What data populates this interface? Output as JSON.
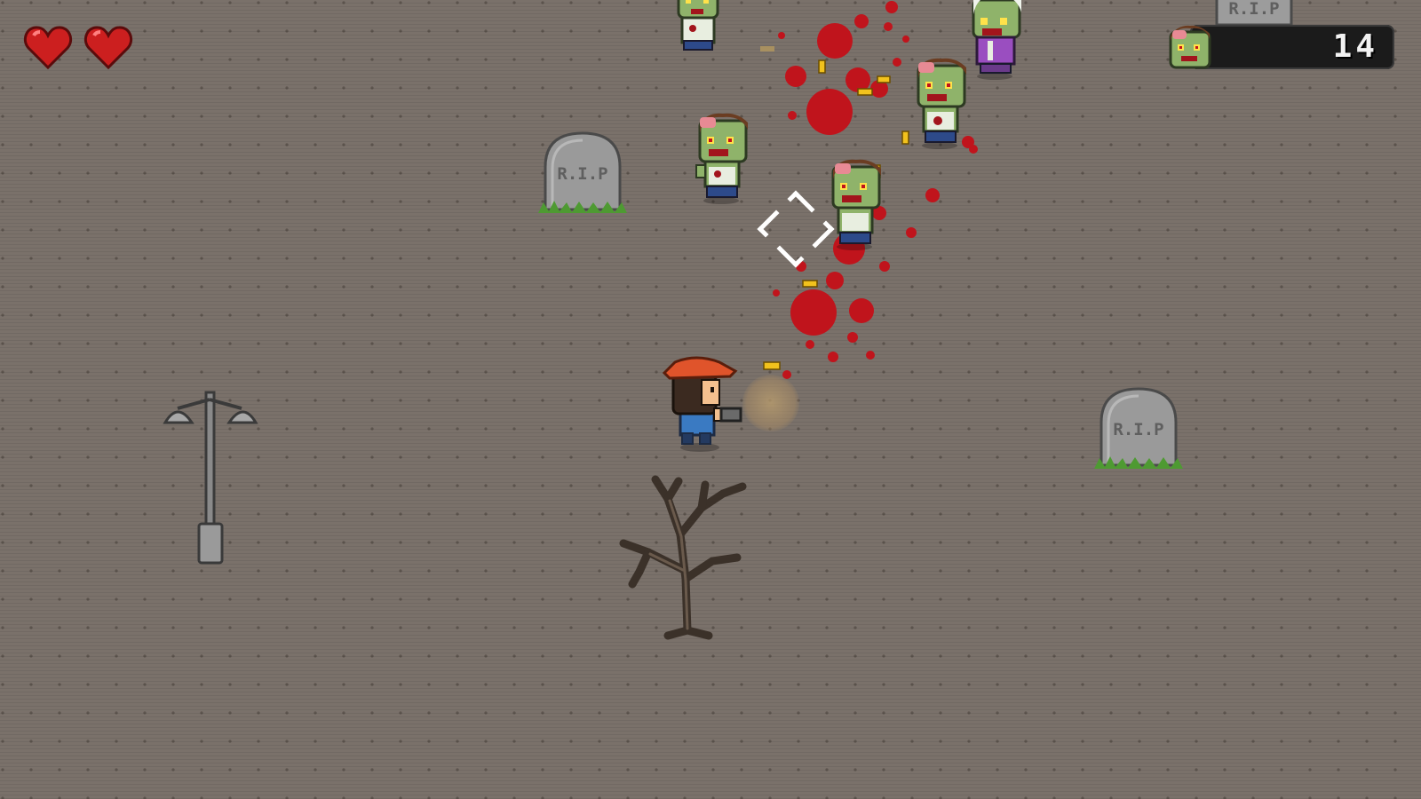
{
  "hud": {
    "lives": 2,
    "kill_count": "14",
    "icons": {
      "life": "heart-icon",
      "kills": "zombie-head-icon"
    }
  },
  "tombstones": [
    {
      "label": "R.I.P"
    },
    {
      "label": "R.I.P"
    },
    {
      "label": "R.I.P"
    }
  ],
  "colors": {
    "ground": "#7a716a",
    "heart": "#cc1f1f",
    "blood": "#c0141c",
    "zombie_skin": "#8fb36a",
    "bullet": "#f2c21d"
  }
}
